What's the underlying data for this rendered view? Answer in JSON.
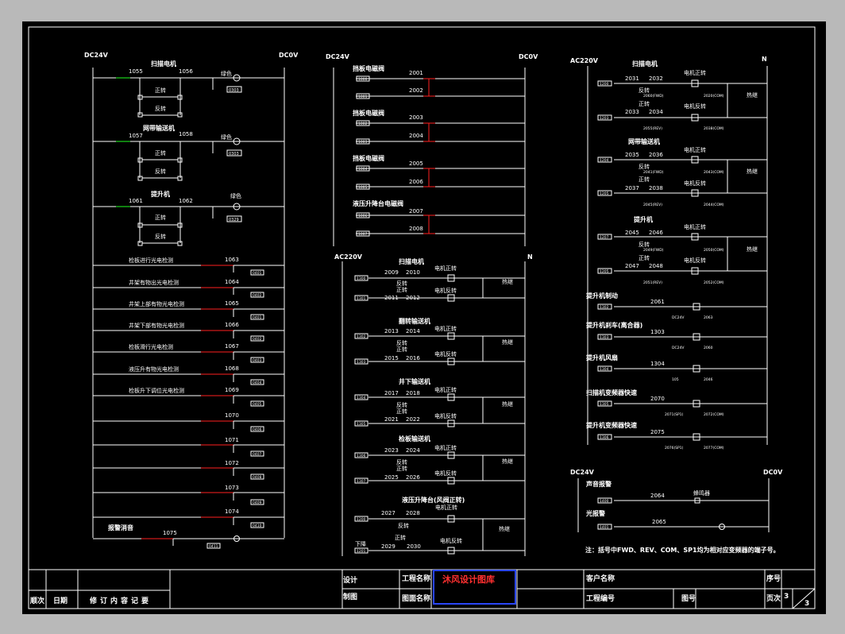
{
  "sec1": {
    "left_supply": "DC24V",
    "right_supply": "DC0V",
    "rows": [
      {
        "title": "扫描电机",
        "contact_a": "1055",
        "contact_b": "1056",
        "fwd": "正转",
        "rev": "反转",
        "lamp": "绿色",
        "tag": "0303"
      },
      {
        "title": "网带输送机",
        "contact_a": "1057",
        "contact_b": "1058",
        "fwd": "正转",
        "rev": "反转",
        "lamp": "绿色",
        "tag": "0303"
      },
      {
        "title": "提升机",
        "contact_a": "1061",
        "contact_b": "1062",
        "fwd": "正转",
        "rev": "反转",
        "lamp": "绿色",
        "tag": "0329"
      }
    ],
    "sensors": [
      {
        "label": "检板进行光电检测",
        "number": "1063",
        "tag": "0401"
      },
      {
        "label": "井架有物出光电检测",
        "number": "1064",
        "tag": "0402"
      },
      {
        "label": "井架上部有物光电检测",
        "number": "1065",
        "tag": "0401"
      },
      {
        "label": "井架下部有物光电检测",
        "number": "1066",
        "tag": "0402"
      },
      {
        "label": "检板滑行光电检测",
        "number": "1067",
        "tag": "0403"
      },
      {
        "label": "液压升有物光电检测",
        "number": "1068",
        "tag": "0404"
      },
      {
        "label": "检板升下调位光电检测",
        "number": "1069",
        "tag": "0405"
      },
      {
        "label": "",
        "number": "1070",
        "tag": "0406"
      },
      {
        "label": "",
        "number": "1071",
        "tag": "0407"
      },
      {
        "label": "",
        "number": "1072",
        "tag": "0408"
      },
      {
        "label": "",
        "number": "1073",
        "tag": "0409"
      },
      {
        "label": "",
        "number": "1074",
        "tag": "0410"
      }
    ],
    "alarm": {
      "label": "报警消音",
      "number": "1075",
      "tag": "0411"
    }
  },
  "sec2": {
    "left_supply": "DC24V",
    "right_supply": "DC0V",
    "groups": [
      {
        "title": "挡板电磁阀",
        "n1": "2001",
        "n2": "2002",
        "tag1": "1000",
        "tag2": "1001"
      },
      {
        "title": "挡板电磁阀",
        "n1": "2003",
        "n2": "2004",
        "tag1": "1002",
        "tag2": "1003"
      },
      {
        "title": "挡板电磁阀",
        "n1": "2005",
        "n2": "2006",
        "tag1": "1004",
        "tag2": "1005"
      },
      {
        "title": "液压升降台电磁阀",
        "n1": "2007",
        "n2": "2008",
        "tag1": "1006",
        "tag2": "1007"
      }
    ]
  },
  "sec3": {
    "left_supply": "AC220V",
    "right_supply": "N",
    "groups": [
      {
        "title": "扫描电机",
        "a1": "2009",
        "a2": "2010",
        "b1": "2011",
        "b2": "2012",
        "rev": "反转",
        "fwd": "正转",
        "coil1": "电机正转",
        "coil2": "电机反转",
        "ol": "热继",
        "tag1": "1300",
        "tag2": "1301"
      },
      {
        "title": "翻转输送机",
        "a1": "2013",
        "a2": "2014",
        "b1": "2015",
        "b2": "2016",
        "rev": "反转",
        "fwd": "正转",
        "coil1": "电机正转",
        "coil2": "电机反转",
        "ol": "热继",
        "tag1": "1302",
        "tag2": "1303"
      },
      {
        "title": "井下输送机",
        "a1": "2017",
        "a2": "2018",
        "b1": "2021",
        "b2": "2022",
        "rev": "反转",
        "fwd": "正转",
        "coil1": "电机正转",
        "coil2": "电机反转",
        "ol": "热继",
        "tag1": "1304",
        "tag2": "1305"
      },
      {
        "title": "检板输送机",
        "a1": "2023",
        "a2": "2024",
        "b1": "2025",
        "b2": "2026",
        "rev": "反转",
        "fwd": "正转",
        "coil1": "电机正转",
        "coil2": "电机反转",
        "ol": "热继",
        "tag1": "1306",
        "tag2": "1307"
      },
      {
        "title": "液压升降台(风阀正转)",
        "a1": "2027",
        "a2": "2028",
        "b1": "2029",
        "b2": "2030",
        "rev": "反转",
        "fwd": "正转",
        "coil1": "电机正转",
        "coil2": "电机反转",
        "ol": "热继",
        "tag1": "1200",
        "tag2": "1201"
      }
    ],
    "extra": "下降"
  },
  "sec4": {
    "left_supply": "AC220V",
    "right_supply": "N",
    "groups": [
      {
        "title": "扫描电机",
        "a1": "2031",
        "a2": "2032",
        "b1": "2033",
        "b2": "2034",
        "rev": "反转",
        "fwd": "正转",
        "coil1": "电机正转",
        "coil2": "电机反转",
        "ol": "热继",
        "tag1": "1200",
        "tag2": "1203",
        "sub1": "2060(FWD)",
        "sub2": "2020(COM)",
        "sub3": "2055(REV)",
        "sub4": "2038(COM)"
      },
      {
        "title": "网带输送机",
        "a1": "2035",
        "a2": "2036",
        "b1": "2037",
        "b2": "2038",
        "rev": "反转",
        "fwd": "正转",
        "coil1": "电机正转",
        "coil2": "电机反转",
        "ol": "热继",
        "tag1": "1204",
        "tag2": "1205",
        "sub1": "2041(FWD)",
        "sub2": "2043(COM)",
        "sub3": "2045(REV)",
        "sub4": "2044(COM)"
      },
      {
        "title": "提升机",
        "a1": "2045",
        "a2": "2046",
        "b1": "2047",
        "b2": "2048",
        "rev": "反转",
        "fwd": "正转",
        "coil1": "电机正转",
        "coil2": "电机反转",
        "ol": "热继",
        "tag1": "1207",
        "tag2": "1205",
        "sub1": "2049(FWD)",
        "sub2": "2050(COM)",
        "sub3": "2051(REV)",
        "sub4": "2052(COM)"
      }
    ],
    "singles": [
      {
        "title": "提升机制动",
        "number": "2061",
        "tag": "1302",
        "sub1": "DC24V",
        "sub2": "2063"
      },
      {
        "title": "提升机刹车(离合器)",
        "number": "1303",
        "tag": "1303",
        "sub1": "DC24V",
        "sub2": "2060"
      },
      {
        "title": "提升机风扇",
        "number": "1304",
        "tag": "1304",
        "sub1": "105",
        "sub2": "2046"
      },
      {
        "title": "扫描机变频器快速",
        "number": "2070",
        "tag": "1305",
        "sub1": "2071(SP1)",
        "sub2": "2072(COM)"
      },
      {
        "title": "提升机变频器快速",
        "number": "2075",
        "tag": "1306",
        "sub1": "2076(SP1)",
        "sub2": "2077(COM)"
      }
    ],
    "dc": {
      "left_supply": "DC24V",
      "right_supply": "DC0V",
      "rows": [
        {
          "title": "声音报警",
          "number": "2064",
          "device": "蜂鸣器",
          "tag": "1400"
        },
        {
          "title": "光报警",
          "number": "2065",
          "device": "",
          "tag": "1401"
        }
      ]
    },
    "note": "注：括号中FWD、REV、COM、SP1均为相对应变频器的端子号。"
  },
  "title_block": {
    "row_labels": [
      "顺次",
      "日期",
      "修订内容记要"
    ],
    "design": "设计",
    "draw": "制图",
    "project_name": "工程名称",
    "drawing_name": "图面名称",
    "customer_name": "客户名称",
    "project_no": "工程编号",
    "drawing_no": "图号",
    "seq": "序号",
    "page_no": "页次",
    "page_value": "3",
    "total_value": "3",
    "watermark": "沐风设计图库"
  }
}
